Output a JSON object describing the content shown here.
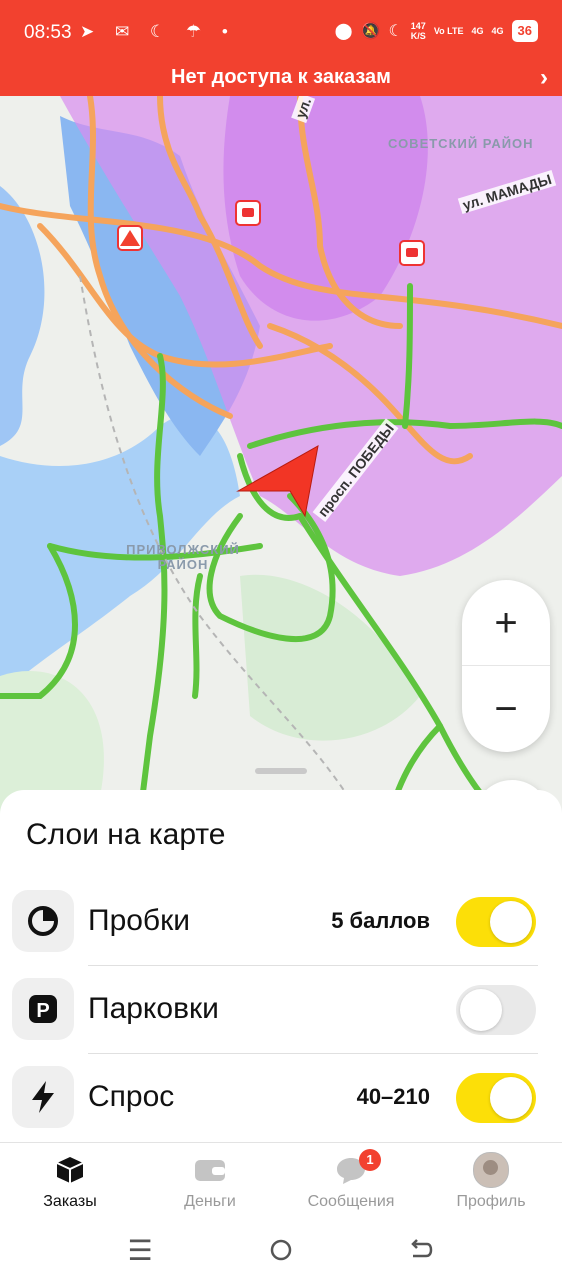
{
  "status_bar": {
    "time": "08:53",
    "left_icons": [
      "telegram-icon",
      "mail-icon",
      "moon-icon",
      "umbrella-icon",
      "dot-icon"
    ],
    "network_speed": "147",
    "network_speed_unit": "K/S",
    "volte": "Vo LTE",
    "net1": "4G",
    "net2": "4G",
    "battery": "36"
  },
  "banner": {
    "text": "Нет доступа к заказам"
  },
  "map": {
    "labels": {
      "district_sovetsky": "СОВЕТСКИЙ РАЙОН",
      "district_privolzhsky": "ПРИВОЛЖСКИЙ РАЙОН",
      "street_mamadysh": "ул. МАМАДЫ",
      "street_pobedy": "просп. ПОБЕДЫ",
      "street_top": "ул."
    },
    "zoom_in": "+",
    "zoom_out": "−",
    "close": "✕"
  },
  "sheet": {
    "title": "Слои на карте",
    "layers": [
      {
        "label": "Пробки",
        "value": "5 баллов",
        "enabled": true,
        "icon": "traffic-icon"
      },
      {
        "label": "Парковки",
        "value": "",
        "enabled": false,
        "icon": "parking-icon"
      },
      {
        "label": "Спрос",
        "value": "40–210",
        "enabled": true,
        "icon": "lightning-icon"
      }
    ]
  },
  "tabs": [
    {
      "label": "Заказы",
      "active": true,
      "icon": "box-icon"
    },
    {
      "label": "Деньги",
      "active": false,
      "icon": "wallet-icon"
    },
    {
      "label": "Сообщения",
      "active": false,
      "icon": "chat-icon",
      "badge": "1"
    },
    {
      "label": "Профиль",
      "active": false,
      "icon": "avatar"
    }
  ],
  "colors": {
    "accent_red": "#f2412f",
    "toggle_on": "#fcdf08",
    "traffic_green": "#5ec43e",
    "traffic_orange": "#f5a45c",
    "demand_purple": "#d98cf0"
  }
}
